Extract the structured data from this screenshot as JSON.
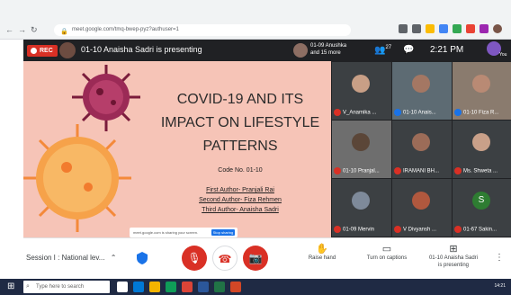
{
  "browser": {
    "url": "meet.google.com/tmq-bwep-pyz?authuser=1"
  },
  "meet_header": {
    "rec_label": "REC",
    "presenting_text": "01-10 Anaisha Sadri is presenting",
    "participants_line1": "01-09 Anushka",
    "participants_line2": "and 15 more",
    "people_count": "27",
    "time": "2:21 PM",
    "you_label": "You"
  },
  "slide": {
    "title_line1": "COVID-19 AND ITS",
    "title_line2": "IMPACT ON LIFESTYLE",
    "title_line3": "PATTERNS",
    "code": "Code No. 01-10",
    "author1": "First Author- Pranjali Rai",
    "author2": "Second Author- Fiza Rehmen",
    "author3": "Third Author- Anaisha Sadri",
    "share_banner_text": "meet.google.com is sharing your screen.",
    "stop_sharing_label": "Stop sharing"
  },
  "tiles": [
    {
      "name": "V_Anamika ..."
    },
    {
      "name": "01-10 Anais..."
    },
    {
      "name": "01-10 Fiza R..."
    },
    {
      "name": "01-10 Pranjal..."
    },
    {
      "name": "IRAMANI BH..."
    },
    {
      "name": "Ms. Shweta ..."
    },
    {
      "name": "01-09 Mervin"
    },
    {
      "name": "V Divyansh ..."
    },
    {
      "name": "01-67 Sakin..."
    }
  ],
  "tile_initial": "S",
  "toolbar": {
    "session_label": "Session I : National lev...",
    "raise_hand_label": "Raise hand",
    "captions_label": "Turn on captions",
    "presenting_line1": "01-10 Anaisha Sadri",
    "presenting_line2": "is presenting"
  },
  "taskbar": {
    "search_placeholder": "Type here to search",
    "tray_time": "14:21"
  }
}
